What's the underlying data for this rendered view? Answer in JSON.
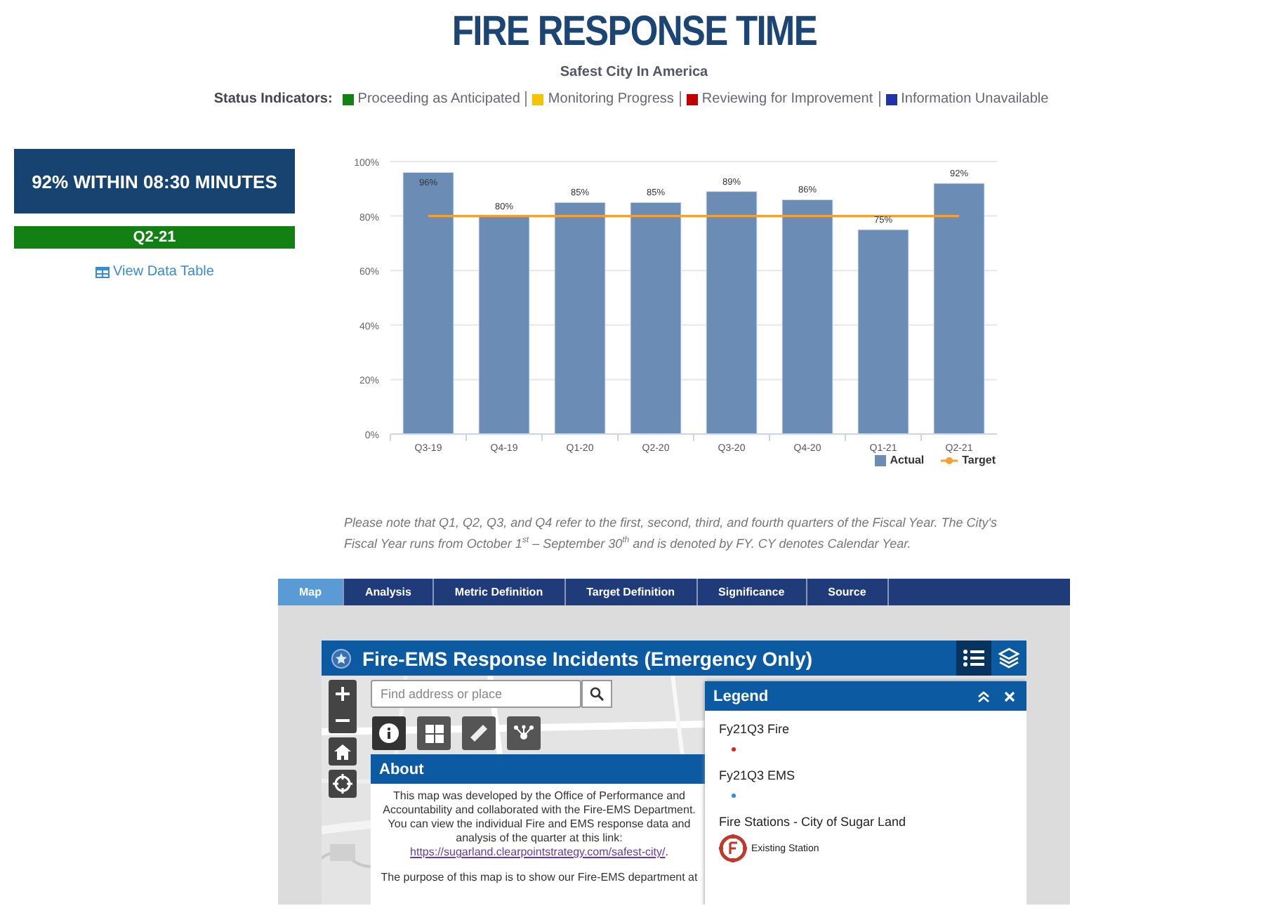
{
  "header": {
    "title": "FIRE RESPONSE TIME",
    "subtitle": "Safest City In America",
    "status_label": "Status Indicators:",
    "status_indicators": [
      {
        "label": "Proceeding as Anticipated",
        "color": "#138013"
      },
      {
        "label": "Monitoring Progress",
        "color": "#f5c400"
      },
      {
        "label": "Reviewing for Improvement",
        "color": "#c00000"
      },
      {
        "label": "Information Unavailable",
        "color": "#2233aa"
      }
    ]
  },
  "summary": {
    "headline": "92% WITHIN 08:30 MINUTES",
    "period": "Q2-21",
    "color": "#138013",
    "link": "View Data Table"
  },
  "chart": {
    "chart_data": {
      "type": "bar",
      "categories": [
        "Q3-19",
        "Q4-19",
        "Q1-20",
        "Q2-20",
        "Q3-20",
        "Q4-20",
        "Q1-21",
        "Q2-21"
      ],
      "series": [
        {
          "name": "Actual",
          "color": "#6b8db5",
          "values": [
            96,
            80,
            85,
            85,
            89,
            86,
            75,
            92
          ]
        },
        {
          "name": "Target",
          "type": "line",
          "color": "#f7a030",
          "values": [
            80,
            80,
            80,
            80,
            80,
            80,
            80,
            80
          ]
        }
      ],
      "ylim": [
        0,
        100
      ],
      "grid": true,
      "yticks": [
        {
          "value": 0,
          "label": "0%"
        },
        {
          "value": 20,
          "label": "20%"
        },
        {
          "value": 40,
          "label": "40%"
        },
        {
          "value": 60,
          "label": "60%"
        },
        {
          "value": 80,
          "label": "80%"
        },
        {
          "value": 100,
          "label": "100%"
        }
      ],
      "value_labels": [
        "96%",
        "80%",
        "85%",
        "85%",
        "89%",
        "86%",
        "75%",
        "92%"
      ]
    }
  },
  "note": "Please note that Q1, Q2, Q3, and Q4 refer to the first, second, third, and fourth quarters of the Fiscal Year. The City's Fiscal Year runs from October 1$^{st}$ – September 30$^{th}$ and is denoted by FY. CY denotes Calendar Year.",
  "tabs": [
    {
      "label": "Map",
      "selected": true
    },
    {
      "label": "Analysis",
      "selected": false
    },
    {
      "label": "Metric Definition",
      "selected": false
    },
    {
      "label": "Target Definition",
      "selected": false
    },
    {
      "label": "Significance",
      "selected": false
    },
    {
      "label": "Source",
      "selected": false
    }
  ],
  "map": {
    "title": "Fire-EMS Response Incidents (Emergency Only)",
    "header_tools": [
      {
        "kind": "legend",
        "selected": true
      },
      {
        "kind": "layers",
        "selected": false
      }
    ],
    "search": {
      "placeholder": "Find address or place"
    },
    "about": {
      "title": "About",
      "intro": "This map was developed by the Office of Performance and Accountability and collaborated with the Fire-EMS Department.",
      "link_prefix": "You can view the individual Fire and EMS response data and analysis of the quarter at this link:",
      "link": "https://sugarland.clearpointstrategy.com/safest-city/",
      "link_suffix": ".",
      "purpose": "The purpose of this map is to show our Fire-EMS department at"
    },
    "legend": {
      "title": "Legend",
      "layers": [
        {
          "name": "Fy21Q3 Fire",
          "kind": "dot",
          "color": "#e02020"
        },
        {
          "name": "Fy21Q3 EMS",
          "kind": "dot",
          "color": "#2a8fe0"
        },
        {
          "name": "Fire Stations - City of Sugar Land",
          "kind": "station",
          "label": "Existing Station"
        }
      ]
    }
  }
}
